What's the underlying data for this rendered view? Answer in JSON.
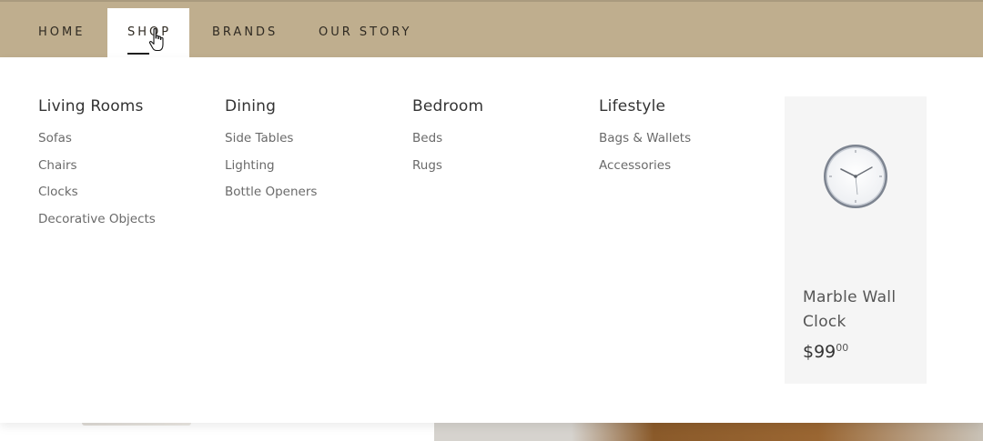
{
  "nav": {
    "items": [
      {
        "label": "HOME"
      },
      {
        "label": "SHOP"
      },
      {
        "label": "BRANDS"
      },
      {
        "label": "OUR STORY"
      }
    ],
    "active": "SHOP",
    "bar_color": "#bfae8e"
  },
  "menu": {
    "columns": [
      {
        "title": "Living Rooms",
        "links": [
          "Sofas",
          "Chairs",
          "Clocks",
          "Decorative Objects"
        ]
      },
      {
        "title": "Dining",
        "links": [
          "Side Tables",
          "Lighting",
          "Bottle Openers"
        ]
      },
      {
        "title": "Bedroom",
        "links": [
          "Beds",
          "Rugs"
        ]
      },
      {
        "title": "Lifestyle",
        "links": [
          "Bags & Wallets",
          "Accessories"
        ]
      }
    ]
  },
  "featured": {
    "name": "Marble Wall Clock",
    "price_main": "$99",
    "price_cents": "00",
    "icon": "wall-clock-icon"
  },
  "cursor": {
    "icon": "hand-pointer-icon"
  }
}
